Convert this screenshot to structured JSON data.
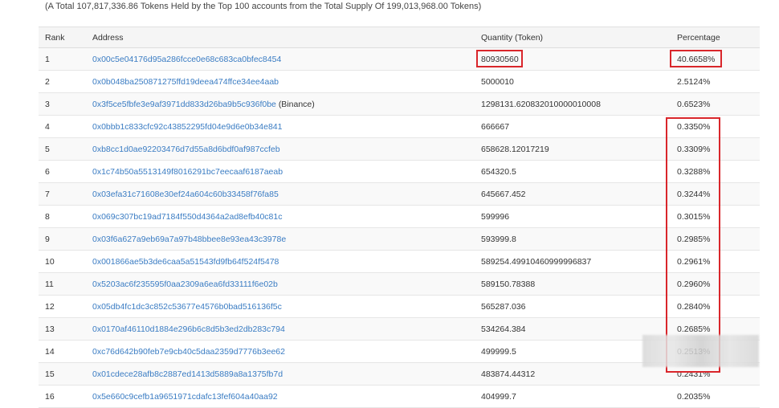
{
  "summary_text": "(A Total 107,817,336.86 Tokens Held by the Top 100 accounts from the Total Supply Of 199,013,968.00 Tokens)",
  "headers": {
    "rank": "Rank",
    "address": "Address",
    "quantity": "Quantity (Token)",
    "percentage": "Percentage"
  },
  "rows": [
    {
      "rank": "1",
      "address": "0x00c5e04176d95a286fcce0e68c683ca0bfec8454",
      "tag": "",
      "quantity": "80930560",
      "percentage": "40.6658%"
    },
    {
      "rank": "2",
      "address": "0x0b048ba250871275ffd19deea474ffce34ee4aab",
      "tag": "",
      "quantity": "5000010",
      "percentage": "2.5124%"
    },
    {
      "rank": "3",
      "address": "0x3f5ce5fbfe3e9af3971dd833d26ba9b5c936f0be",
      "tag": "(Binance)",
      "quantity": "1298131.620832010000010008",
      "percentage": "0.6523%"
    },
    {
      "rank": "4",
      "address": "0x0bbb1c833cfc92c43852295fd04e9d6e0b34e841",
      "tag": "",
      "quantity": "666667",
      "percentage": "0.3350%"
    },
    {
      "rank": "5",
      "address": "0xb8cc1d0ae92203476d7d55a8d6bdf0af987ccfeb",
      "tag": "",
      "quantity": "658628.12017219",
      "percentage": "0.3309%"
    },
    {
      "rank": "6",
      "address": "0x1c74b50a5513149f8016291bc7eecaaf6187aeab",
      "tag": "",
      "quantity": "654320.5",
      "percentage": "0.3288%"
    },
    {
      "rank": "7",
      "address": "0x03efa31c71608e30ef24a604c60b33458f76fa85",
      "tag": "",
      "quantity": "645667.452",
      "percentage": "0.3244%"
    },
    {
      "rank": "8",
      "address": "0x069c307bc19ad7184f550d4364a2ad8efb40c81c",
      "tag": "",
      "quantity": "599996",
      "percentage": "0.3015%"
    },
    {
      "rank": "9",
      "address": "0x03f6a627a9eb69a7a97b48bbee8e93ea43c3978e",
      "tag": "",
      "quantity": "593999.8",
      "percentage": "0.2985%"
    },
    {
      "rank": "10",
      "address": "0x001866ae5b3de6caa5a51543fd9fb64f524f5478",
      "tag": "",
      "quantity": "589254.49910460999996837",
      "percentage": "0.2961%"
    },
    {
      "rank": "11",
      "address": "0x5203ac6f235595f0aa2309a6ea6fd33111f6e02b",
      "tag": "",
      "quantity": "589150.78388",
      "percentage": "0.2960%"
    },
    {
      "rank": "12",
      "address": "0x05db4fc1dc3c852c53677e4576b0bad516136f5c",
      "tag": "",
      "quantity": "565287.036",
      "percentage": "0.2840%"
    },
    {
      "rank": "13",
      "address": "0x0170af46110d1884e296b6c8d5b3ed2db283c794",
      "tag": "",
      "quantity": "534264.384",
      "percentage": "0.2685%"
    },
    {
      "rank": "14",
      "address": "0xc76d642b90feb7e9cb40c5daa2359d7776b3ee62",
      "tag": "",
      "quantity": "499999.5",
      "percentage": "0.2513%"
    },
    {
      "rank": "15",
      "address": "0x01cdece28afb8c2887ed1413d5889a8a1375fb7d",
      "tag": "",
      "quantity": "483874.44312",
      "percentage": "0.2431%"
    },
    {
      "rank": "16",
      "address": "0x5e660c9cefb1a9651971cdafc13fef604a40aa92",
      "tag": "",
      "quantity": "404999.7",
      "percentage": "0.2035%"
    }
  ],
  "colors": {
    "link": "#3a7cc3",
    "highlight_box": "#d9262b",
    "header_bg": "#f5f5f5",
    "stripe_bg": "#f9f9f9"
  }
}
